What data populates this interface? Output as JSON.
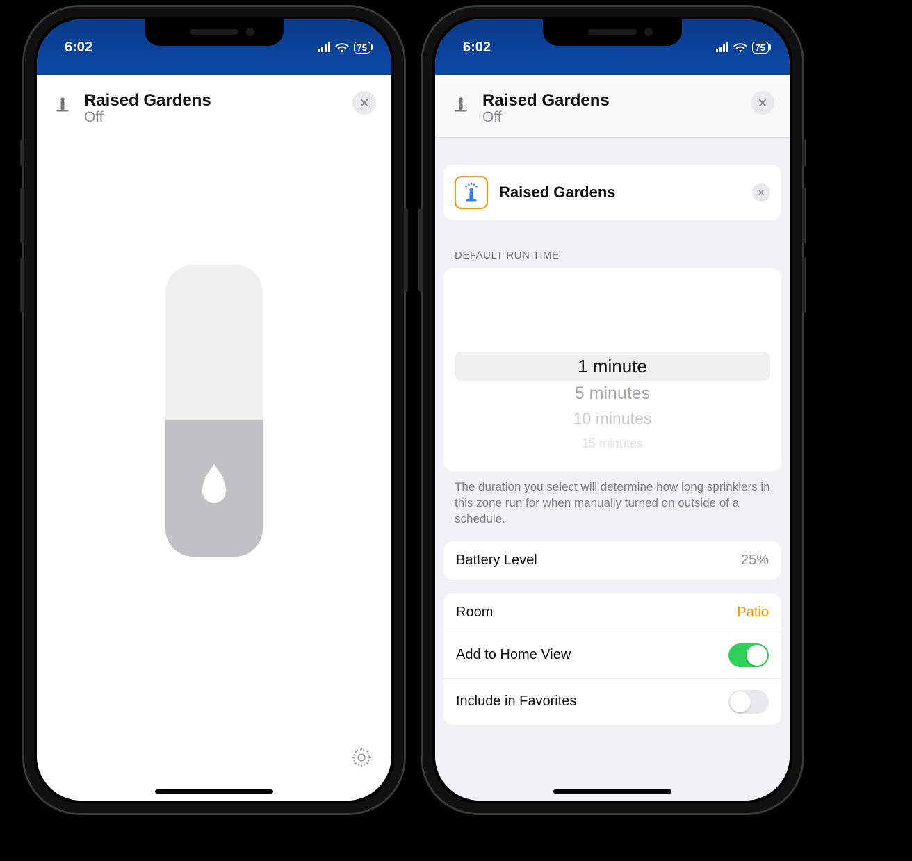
{
  "status": {
    "time": "6:02",
    "battery": "75"
  },
  "header": {
    "title": "Raised Gardens",
    "subtitle": "Off"
  },
  "left": {},
  "right": {
    "tile_title": "Raised Gardens",
    "section_label": "DEFAULT RUN TIME",
    "picker": {
      "selected": "1 minute",
      "opt1": "5 minutes",
      "opt2": "10 minutes",
      "opt3": "15 minutes"
    },
    "help_text": "The duration you select will determine how long sprinklers in this zone run for when manually turned on outside of a schedule.",
    "battery": {
      "label": "Battery Level",
      "value": "25%"
    },
    "room": {
      "label": "Room",
      "value": "Patio"
    },
    "home_view": {
      "label": "Add to Home View",
      "on": true
    },
    "favorites": {
      "label": "Include in Favorites",
      "on": false
    }
  }
}
